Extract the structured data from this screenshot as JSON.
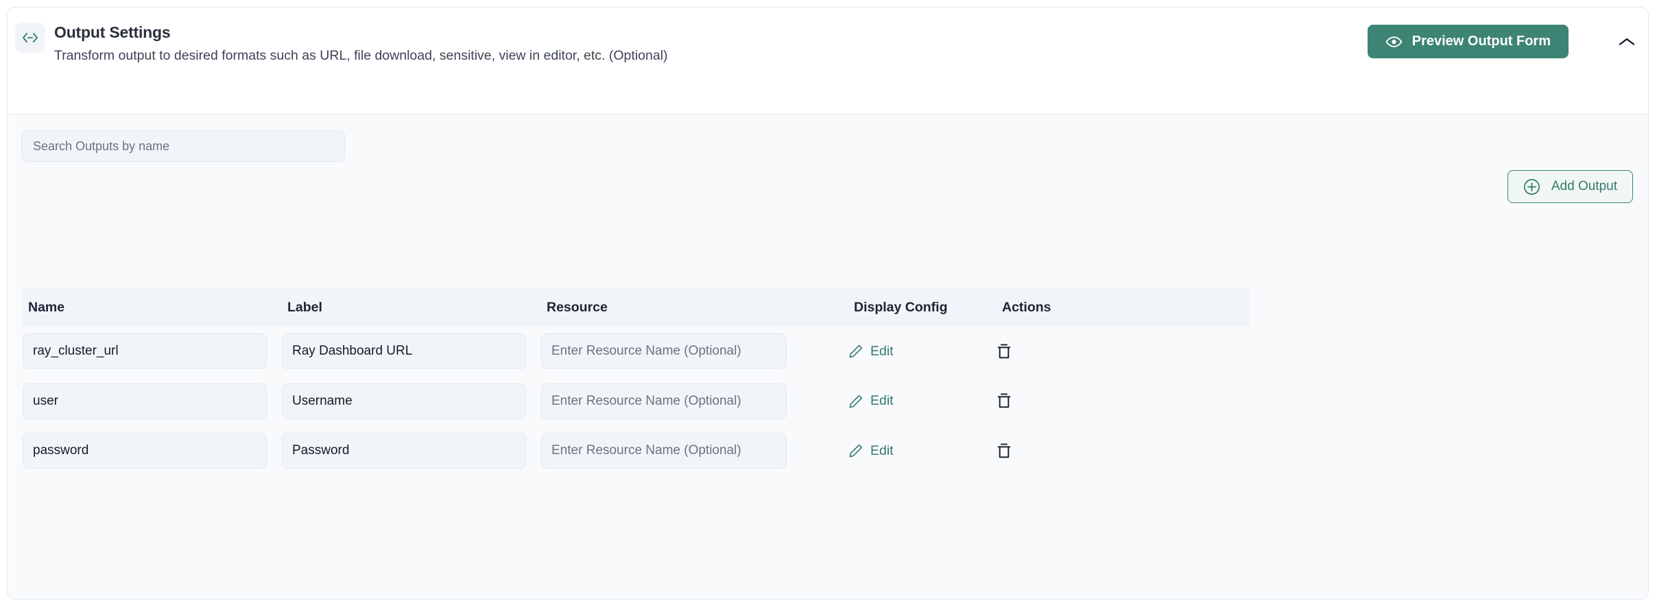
{
  "card": {
    "title": "Output Settings",
    "description": "Transform output to desired formats such as URL, file download, sensitive, view in editor, etc. (Optional)",
    "icon": "code-brackets-icon",
    "preview_button": {
      "label": "Preview Output Form",
      "icon": "eye-icon",
      "color": "#3D8474"
    },
    "collapse_icon": "chevron-up-icon"
  },
  "toolbar": {
    "search_placeholder": "Search Outputs by name",
    "search_value": "",
    "add_output_label": "Add Output",
    "add_output_icon": "plus-circle-icon",
    "accent_color": "#33796A"
  },
  "table": {
    "columns": [
      {
        "key": "name",
        "label": "Name"
      },
      {
        "key": "label",
        "label": "Label"
      },
      {
        "key": "resource",
        "label": "Resource"
      },
      {
        "key": "display_config",
        "label": "Display Config"
      },
      {
        "key": "actions",
        "label": "Actions"
      }
    ],
    "resource_placeholder": "Enter Resource Name (Optional)",
    "edit_label": "Edit",
    "edit_icon": "pencil-icon",
    "delete_icon": "trash-icon",
    "rows": [
      {
        "name": "ray_cluster_url",
        "label": "Ray Dashboard URL",
        "resource": ""
      },
      {
        "name": "user",
        "label": "Username",
        "resource": ""
      },
      {
        "name": "password",
        "label": "Password",
        "resource": ""
      }
    ]
  }
}
